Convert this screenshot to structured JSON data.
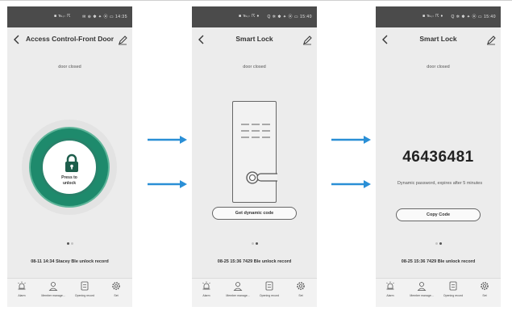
{
  "screens": [
    {
      "status_left": "■ ℡ᵢₗ ☈",
      "status_right": "✉ ⊕ ✽ ✦ ⦿ ▭ 14:35",
      "title": "Access Control-Front Door",
      "door_status": "door closed",
      "unlock_label_1": "Press to",
      "unlock_label_2": "unlock",
      "record": "08-11 14:34 Stacey Ble unlock record"
    },
    {
      "status_left": "■ ℡ᵢₗ ☈ ♦",
      "status_right": "Q ✲ ✽ ✦ ⦿ ▭ 15:40",
      "title": "Smart Lock",
      "door_status": "door closed",
      "button_label": "Get dynamic code",
      "record": "08-25 15:36 7429 Ble unlock record"
    },
    {
      "status_left": "■ ℡ᵢₗ ☈ ♦",
      "status_right": "Q ✲ ✽ ✦ ⦿ ▭ 15:40",
      "title": "Smart Lock",
      "door_status": "door closed",
      "code": "46436481",
      "expire_text": "Dynamic password, expires after 5 minutes",
      "button_label": "Copy Code",
      "record": "08-25 15:36 7429 Ble unlock record"
    }
  ],
  "nav": {
    "alarm": "Alarm",
    "member": "Member manage...",
    "opening": "Opening record",
    "set": "Set"
  },
  "icons": {
    "back": "back-arrow-icon",
    "edit": "pencil-icon",
    "lock": "padlock-icon",
    "alarm": "alarm-icon",
    "member": "person-icon",
    "opening": "record-icon",
    "set": "gear-icon",
    "flow": "right-arrow-icon"
  },
  "colors": {
    "status_bar": "#4b4b4b",
    "screen_bg": "#ececec",
    "ring_green": "#1e8a6c",
    "flow_arrow": "#2a8fd6"
  }
}
